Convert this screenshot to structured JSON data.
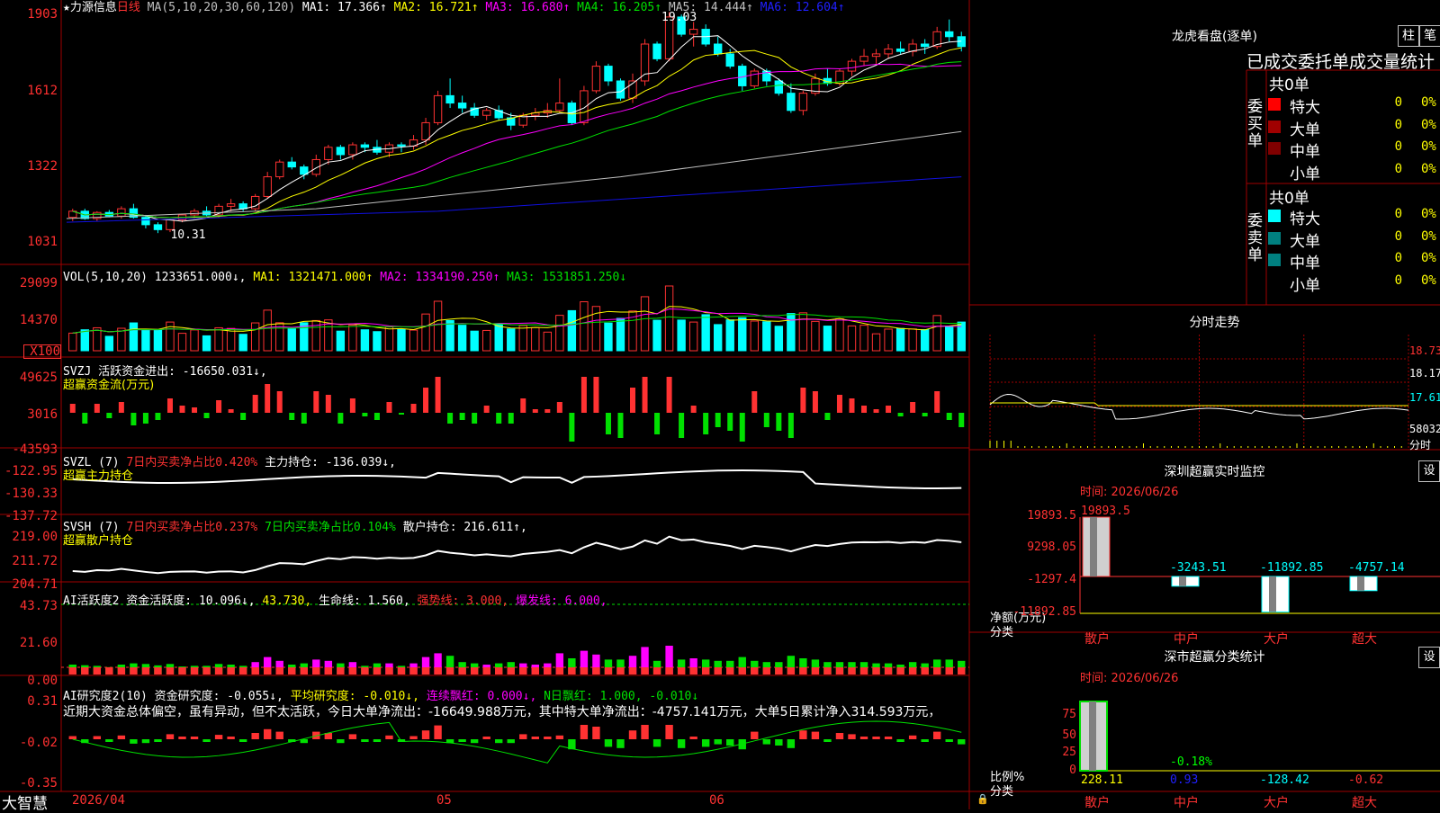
{
  "colors": {
    "red": "#ff3232",
    "cyan": "#00ffff",
    "border": "#a00000",
    "white": "#ffffff",
    "yellow": "#ffff00",
    "magenta": "#ff00ff",
    "green": "#00e000",
    "gray": "#c0c0c0",
    "blue": "#1010e0"
  },
  "bottom_bar": {
    "brand": "大智慧",
    "date_label": "2026/04",
    "months": [
      "05",
      "06"
    ]
  },
  "kline": {
    "title": "★力源信息",
    "period": "日线",
    "ma_label": "MA(5,10,20,30,60,120)",
    "mas": [
      {
        "label": "MA1: 17.366↑",
        "color": "#ffffff"
      },
      {
        "label": "MA2: 16.721↑",
        "color": "#ffff00"
      },
      {
        "label": "MA3: 16.680↑",
        "color": "#ff00ff"
      },
      {
        "label": "MA4: 16.205↑",
        "color": "#00e000"
      },
      {
        "label": "MA5: 14.444↑",
        "color": "#c0c0c0"
      },
      {
        "label": "MA6: 12.604↑",
        "color": "#2020ff"
      }
    ],
    "y_ticks": [
      "1903",
      "1612",
      "1322",
      "1031"
    ],
    "max_label": "19.03",
    "min_label": "10.31",
    "ohlc": [
      [
        10.95,
        11.3,
        10.8,
        11.2
      ],
      [
        11.2,
        11.3,
        10.85,
        10.9
      ],
      [
        10.9,
        11.2,
        10.8,
        11.15
      ],
      [
        11.15,
        11.25,
        10.95,
        11.0
      ],
      [
        11.0,
        11.4,
        10.9,
        11.3
      ],
      [
        11.3,
        11.5,
        10.9,
        10.95
      ],
      [
        10.95,
        11.05,
        10.5,
        10.65
      ],
      [
        10.65,
        10.75,
        10.31,
        10.45
      ],
      [
        10.45,
        10.9,
        10.35,
        10.85
      ],
      [
        10.85,
        11.1,
        10.75,
        11.05
      ],
      [
        11.05,
        11.3,
        10.9,
        11.2
      ],
      [
        11.2,
        11.4,
        11.0,
        11.05
      ],
      [
        11.05,
        11.5,
        10.95,
        11.4
      ],
      [
        11.4,
        11.7,
        11.2,
        11.5
      ],
      [
        11.5,
        11.6,
        11.2,
        11.3
      ],
      [
        11.3,
        11.9,
        11.2,
        11.8
      ],
      [
        11.8,
        12.8,
        11.7,
        12.6
      ],
      [
        12.6,
        13.3,
        12.5,
        13.2
      ],
      [
        13.2,
        13.4,
        12.9,
        13.0
      ],
      [
        13.0,
        13.1,
        12.5,
        12.7
      ],
      [
        12.7,
        13.5,
        12.6,
        13.3
      ],
      [
        13.3,
        13.9,
        13.1,
        13.8
      ],
      [
        13.8,
        13.9,
        13.3,
        13.5
      ],
      [
        13.5,
        14.0,
        13.3,
        13.9
      ],
      [
        13.9,
        14.0,
        13.6,
        13.8
      ],
      [
        13.8,
        14.1,
        13.5,
        13.6
      ],
      [
        13.6,
        14.0,
        13.4,
        13.9
      ],
      [
        13.9,
        14.0,
        13.6,
        13.85
      ],
      [
        13.85,
        14.3,
        13.7,
        14.1
      ],
      [
        14.1,
        15.0,
        13.9,
        14.8
      ],
      [
        14.8,
        16.1,
        14.7,
        15.9
      ],
      [
        15.9,
        16.6,
        15.4,
        15.6
      ],
      [
        15.6,
        15.9,
        15.2,
        15.4
      ],
      [
        15.4,
        15.6,
        15.0,
        15.1
      ],
      [
        15.1,
        15.4,
        14.9,
        15.3
      ],
      [
        15.3,
        15.5,
        14.9,
        15.0
      ],
      [
        15.0,
        15.2,
        14.5,
        14.7
      ],
      [
        14.7,
        15.2,
        14.6,
        15.1
      ],
      [
        15.1,
        15.4,
        14.9,
        15.2
      ],
      [
        15.2,
        15.6,
        15.0,
        15.3
      ],
      [
        15.3,
        16.6,
        15.2,
        15.6
      ],
      [
        15.6,
        15.7,
        14.7,
        14.8
      ],
      [
        14.8,
        16.3,
        14.7,
        16.1
      ],
      [
        16.1,
        17.3,
        16.0,
        17.1
      ],
      [
        17.1,
        17.2,
        16.3,
        16.5
      ],
      [
        16.5,
        16.6,
        15.7,
        15.8
      ],
      [
        15.8,
        16.8,
        15.6,
        16.5
      ],
      [
        16.5,
        18.2,
        16.3,
        18.0
      ],
      [
        18.0,
        18.1,
        17.3,
        17.4
      ],
      [
        17.4,
        19.3,
        17.3,
        19.1
      ],
      [
        19.1,
        19.2,
        18.3,
        18.4
      ],
      [
        18.4,
        18.9,
        17.9,
        18.6
      ],
      [
        18.6,
        18.8,
        17.9,
        18.0
      ],
      [
        18.0,
        18.3,
        17.5,
        17.6
      ],
      [
        17.6,
        17.8,
        17.0,
        17.1
      ],
      [
        17.1,
        17.2,
        16.1,
        16.3
      ],
      [
        16.3,
        17.0,
        16.2,
        16.9
      ],
      [
        16.9,
        17.0,
        16.3,
        16.5
      ],
      [
        16.5,
        16.6,
        15.9,
        16.0
      ],
      [
        16.0,
        16.4,
        15.2,
        15.3
      ],
      [
        15.3,
        16.1,
        15.1,
        16.0
      ],
      [
        16.0,
        16.8,
        15.9,
        16.6
      ],
      [
        16.6,
        17.0,
        16.3,
        16.4
      ],
      [
        16.4,
        17.0,
        16.3,
        16.9
      ],
      [
        16.9,
        17.4,
        16.7,
        17.3
      ],
      [
        17.3,
        17.8,
        17.1,
        17.5
      ],
      [
        17.5,
        17.8,
        17.2,
        17.6
      ],
      [
        17.6,
        18.0,
        17.4,
        17.8
      ],
      [
        17.8,
        18.1,
        17.6,
        17.7
      ],
      [
        17.7,
        18.2,
        17.5,
        18.0
      ],
      [
        18.0,
        18.2,
        17.6,
        17.9
      ],
      [
        17.9,
        18.7,
        17.8,
        18.5
      ],
      [
        18.5,
        19.0,
        18.1,
        18.3
      ],
      [
        18.3,
        18.5,
        17.7,
        17.9
      ]
    ]
  },
  "vol": {
    "header": "VOL(5,10,20) 1233651.000↓, ",
    "mas": [
      {
        "label": "MA1: 1321471.000↑",
        "color": "#ffff00"
      },
      {
        "label": "MA2: 1334190.250↑",
        "color": "#ff00ff"
      },
      {
        "label": "MA3: 1531851.250↓",
        "color": "#00e000"
      }
    ],
    "y_ticks": [
      "29099",
      "14370"
    ],
    "unit_label": "X100"
  },
  "svzj": {
    "header": "SVZJ  活跃资金进出: -16650.031↓,",
    "sub": "超赢资金流(万元)",
    "y_ticks": [
      "49625",
      "3016",
      "-43593"
    ]
  },
  "svzl": {
    "header_a": "SVZL (7)",
    "header_b": "7日内买卖净占比0.420%",
    "header_c": "主力持仓: -136.039↓,",
    "sub": "超赢主力持仓",
    "y_ticks": [
      "-122.95",
      "-130.33",
      "-137.72"
    ]
  },
  "svsh": {
    "header_a": "SVSH (7)",
    "header_b": "7日内买卖净占比0.237%",
    "header_c": "7日内买卖净占比0.104%",
    "header_d": "散户持仓: 216.611↑,",
    "sub": "超赢散户持仓",
    "y_ticks": [
      "219.00",
      "211.72",
      "204.71"
    ]
  },
  "ai1": {
    "header_a": "AI活跃度2 资金活跃度: 10.096↓,",
    "header_b": "43.730,",
    "header_c": "生命线: 1.560,",
    "header_d": "强势线: 3.000,",
    "header_e": "爆发线: 6.000,",
    "y_ticks": [
      "43.73",
      "21.60",
      "0.00"
    ]
  },
  "ai2": {
    "header_a": "AI研究度2(10) 资金研究度: -0.055↓,",
    "header_b": "平均研究度: -0.010↓,",
    "header_c": "连续飘红: 0.000↓,",
    "header_d": "N日飘红: 1.000,",
    "header_e": "-0.010↓",
    "text": "近期大资金总体偏空，虽有异动，但不太活跃，今日大单净流出：-16649.988万元，其中特大单净流出：-4757.141万元，大单5日累计净入314.593万元，",
    "y_ticks": [
      "0.31",
      "-0.02",
      "-0.35"
    ]
  },
  "dragon": {
    "title": "龙虎看盘(逐单)",
    "tabs": [
      "柱",
      "笔"
    ],
    "subtitle": "已成交委托单成交量统计",
    "buy": {
      "side_label": "委买单",
      "total": "共0单",
      "rows": [
        {
          "name": "特大",
          "value": "0",
          "pct": "0%",
          "color": "#ff0000"
        },
        {
          "name": "大单",
          "value": "0",
          "pct": "0%",
          "color": "#a00000"
        },
        {
          "name": "中单",
          "value": "0",
          "pct": "0%",
          "color": "#800000"
        },
        {
          "name": "小单",
          "value": "0",
          "pct": "0%",
          "color": ""
        }
      ]
    },
    "sell": {
      "side_label": "委卖单",
      "total": "共0单",
      "rows": [
        {
          "name": "特大",
          "value": "0",
          "pct": "0%",
          "color": "#00ffff"
        },
        {
          "name": "大单",
          "value": "0",
          "pct": "0%",
          "color": "#008080"
        },
        {
          "name": "中单",
          "value": "0",
          "pct": "0%",
          "color": "#008080"
        },
        {
          "name": "小单",
          "value": "0",
          "pct": "0%",
          "color": ""
        }
      ]
    }
  },
  "intraday": {
    "title": "分时走势",
    "right_labels": [
      "18.73",
      "18.17",
      "17.61",
      "58032",
      "分时"
    ]
  },
  "sz_monitor": {
    "title": "深圳超赢实时监控",
    "set_label": "设",
    "time": "时间: 2026/06/26",
    "y_ticks": [
      "19893.5",
      "9298.05",
      "-1297.4",
      "-11892.85"
    ],
    "ylabel": "净额(万元)",
    "xlabel": "分类",
    "chart_data": {
      "type": "bar",
      "categories": [
        "散户",
        "中户",
        "大户",
        "超大"
      ],
      "values": [
        19893.5,
        -3243.51,
        -11892.85,
        -4757.14
      ],
      "value_labels": [
        "19893.5",
        "-3243.51",
        "-11892.85",
        "-4757.14"
      ],
      "ylim": [
        -11892.85,
        19893.5
      ],
      "ylabel": "净额(万元)",
      "xlabel": "分类"
    }
  },
  "sz_class": {
    "title": "深市超赢分类统计",
    "set_label": "设",
    "time": "时间: 2026/06/26",
    "y_ticks": [
      "75",
      "50",
      "25",
      "0"
    ],
    "ylabel": "比例%",
    "xlabel": "分类",
    "annot": "-0.18%",
    "chart_data": {
      "type": "bar",
      "categories": [
        "散户",
        "中户",
        "大户",
        "超大"
      ],
      "values": [
        228.11,
        0.93,
        -128.42,
        -0.62
      ],
      "value_labels": [
        "228.11",
        "0.93",
        "-128.42",
        "-0.62"
      ],
      "ylabel": "比例%",
      "xlabel": "分类"
    }
  }
}
